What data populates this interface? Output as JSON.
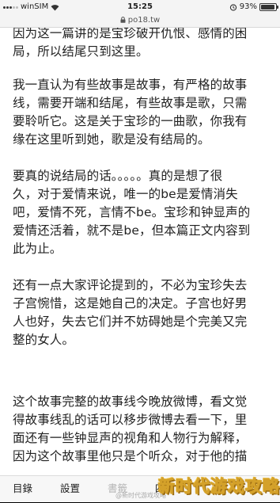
{
  "status_bar": {
    "carrier": "winSIM",
    "time": "15:25",
    "battery": "93%"
  },
  "url_bar": {
    "url": "po18.tw"
  },
  "content": {
    "paragraphs": [
      "因为这一篇讲的是宝珍破开仇恨、感情的困\n局，所以结尾只到这里。",
      "我一直认为有些故事是故事，有严格的故事\n线，需要开端和结尾，有些故事是歌，只需\n要聆听它。这是关于宝珍的一曲歌，你我有\n缘在这里听到她，歌是没有结局的。",
      "要真的说结局的话。。。。。真的是想了很\n久，对于爱情来说，唯一的be是爱情消失\n吧，爱情不死，言情不be。宝珍和钟显声的\n爱情还活着，就不是be，但本篇正文内容到\n此为止。",
      "还有一点大家评论提到的，不必为宝珍失去\n子宫惋惜，这是她自己的决定。子宫也好男\n人也好，失去它们并不妨碍她是个完美又完\n整的女人。",
      "这个故事完整的故事线今晚放微博，看文觉\n得故事线乱的话可以移步微博去看一下，里\n面还有一些钟显声的视角和人物行为解释，\n因为这个故事里他只是个听众，对于他的描"
    ]
  },
  "toolbar": {
    "toc_label": "目錄",
    "settings_label": "設置",
    "bookmark_label": "書籤",
    "extra_label": "四"
  },
  "watermark": {
    "small_text": "@新时代游戏攻略",
    "brand_text": "新时代游戏攻略"
  }
}
